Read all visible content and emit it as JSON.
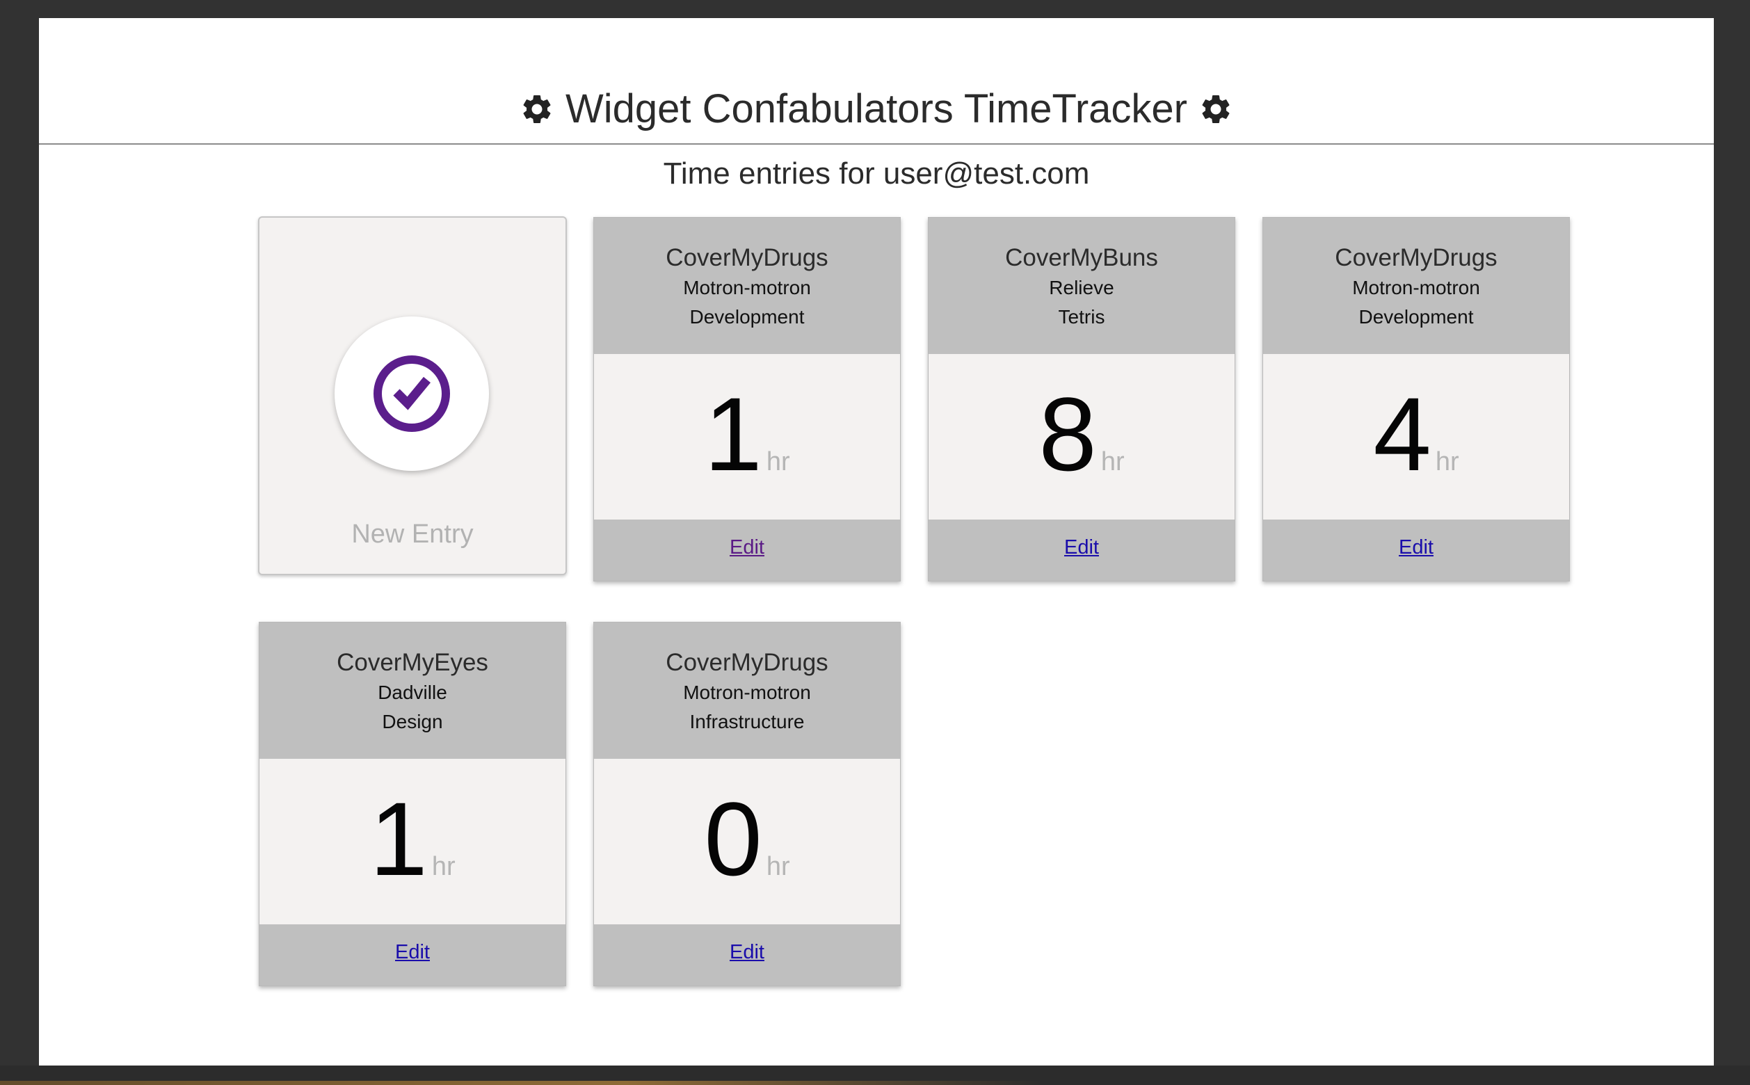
{
  "header": {
    "title": "Widget Confabulators TimeTracker",
    "left_icon": "gear-icon",
    "right_icon": "gear-icon"
  },
  "subtitle": {
    "prefix": "Time entries for",
    "user_email": "user@test.com"
  },
  "new_entry": {
    "label": "New Entry",
    "icon": "clock-check-icon",
    "icon_color": "#5b1e8c"
  },
  "entries": [
    {
      "client": "CoverMyDrugs",
      "project": "Motron-motron",
      "task": "Development",
      "hours": "1",
      "unit": "hr",
      "edit_label": "Edit"
    },
    {
      "client": "CoverMyBuns",
      "project": "Relieve",
      "task": "Tetris",
      "hours": "8",
      "unit": "hr",
      "edit_label": "Edit"
    },
    {
      "client": "CoverMyDrugs",
      "project": "Motron-motron",
      "task": "Development",
      "hours": "4",
      "unit": "hr",
      "edit_label": "Edit"
    },
    {
      "client": "CoverMyEyes",
      "project": "Dadville",
      "task": "Design",
      "hours": "1",
      "unit": "hr",
      "edit_label": "Edit"
    },
    {
      "client": "CoverMyDrugs",
      "project": "Motron-motron",
      "task": "Infrastructure",
      "hours": "0",
      "unit": "hr",
      "edit_label": "Edit"
    }
  ],
  "colors": {
    "card_header": "#bfbfbf",
    "card_body": "#f4f2f1",
    "link": "#1a0dab",
    "visited_link": "#5a1a86"
  }
}
